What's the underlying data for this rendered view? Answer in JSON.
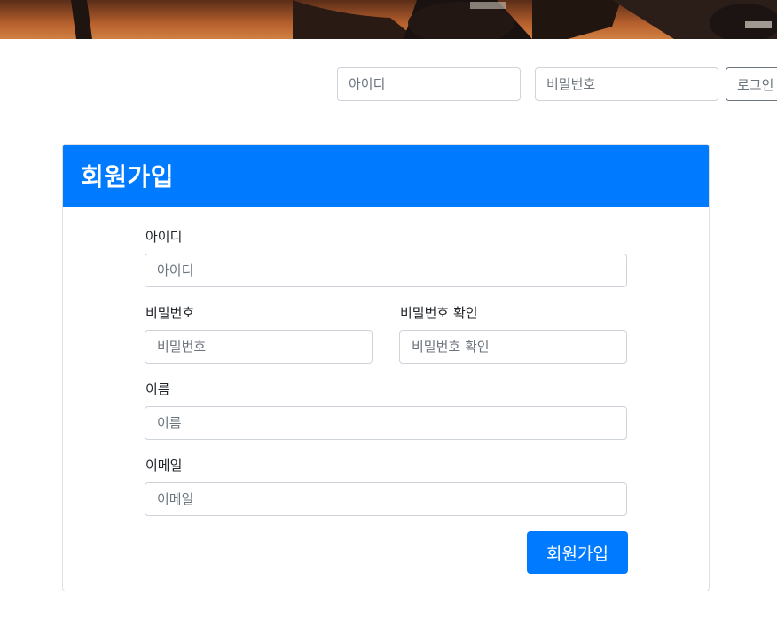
{
  "login_bar": {
    "id_placeholder": "아이디",
    "pw_placeholder": "비밀번호",
    "login_label": "로그인"
  },
  "signup": {
    "title": "회원가입",
    "id_label": "아이디",
    "id_placeholder": "아이디",
    "pw_label": "비밀번호",
    "pw_placeholder": "비밀번호",
    "pw_confirm_label": "비밀번호 확인",
    "pw_confirm_placeholder": "비밀번호 확인",
    "name_label": "이름",
    "name_placeholder": "이름",
    "email_label": "이메일",
    "email_placeholder": "이메일",
    "submit_label": "회원가입"
  },
  "colors": {
    "primary": "#007bff",
    "banner": "#b9642f"
  }
}
